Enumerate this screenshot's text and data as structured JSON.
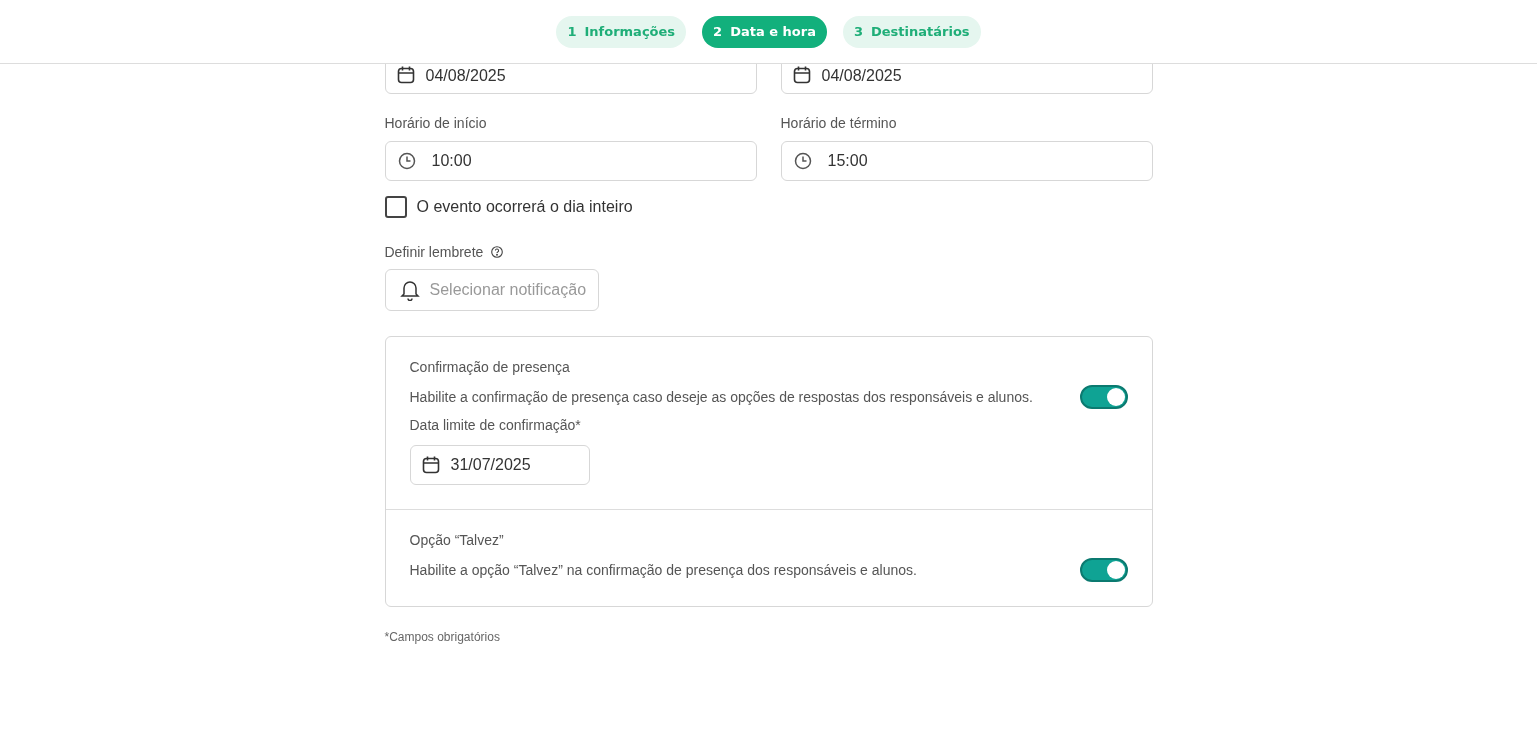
{
  "steps": [
    {
      "number": "1",
      "label": "Informações",
      "selected": false
    },
    {
      "number": "2",
      "label": "Data e hora",
      "selected": true
    },
    {
      "number": "3",
      "label": "Destinatários",
      "selected": false
    }
  ],
  "date_fields": [
    {
      "value": "04/08/2025"
    },
    {
      "value": "04/08/2025"
    }
  ],
  "time_fields": [
    {
      "label": "Horário de início",
      "value": "10:00"
    },
    {
      "label": "Horário de término",
      "value": "15:00"
    }
  ],
  "all_day": {
    "label": "O evento ocorrerá o dia inteiro",
    "checked": false
  },
  "reminder": {
    "label": "Definir lembrete",
    "placeholder": "Selecionar notificação"
  },
  "options": [
    {
      "title": "Confirmação de presença",
      "description": "Habilite a confirmação de presença caso deseje as opções de respostas dos responsáveis e alunos.",
      "on": true,
      "deadline": {
        "label": "Data limite de confirmação*",
        "value": "31/07/2025"
      }
    },
    {
      "title": "Opção “Talvez”",
      "description": "Habilite a opção “Talvez” na confirmação de presença dos responsáveis e alunos.",
      "on": true
    }
  ],
  "footnote": "*Campos obrigatórios"
}
